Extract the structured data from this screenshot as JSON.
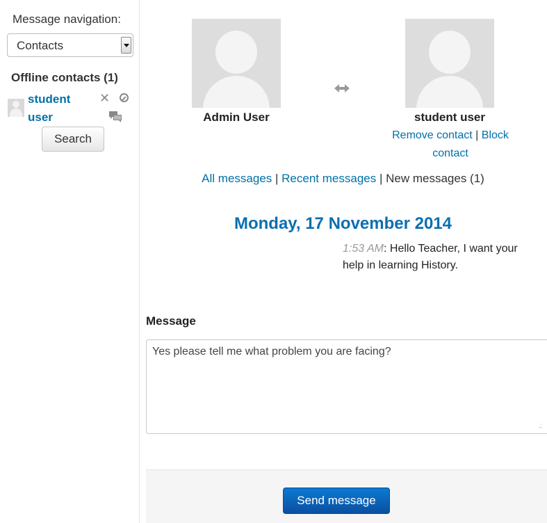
{
  "sidebar": {
    "nav_label": "Message navigation:",
    "select_value": "Contacts",
    "offline_heading": "Offline contacts (1)",
    "contact": {
      "name": "student user",
      "remove_icon": "close-icon",
      "block_icon": "block-icon",
      "chat_icon": "chat-icon"
    },
    "search_label": "Search"
  },
  "conversation": {
    "left_user": "Admin User",
    "right_user": "student user",
    "swap_icon": "double-arrow-icon",
    "remove_contact_label": "Remove contact",
    "separator": " | ",
    "block_contact_label": "Block contact"
  },
  "message_links": {
    "all": "All messages",
    "recent": "Recent messages",
    "new": "New messages (1)",
    "separator": " | "
  },
  "history": {
    "date": "Monday, 17 November 2014",
    "messages": [
      {
        "time": "1:53 AM",
        "separator": ": ",
        "text": "Hello Teacher, I want your help in learning History."
      }
    ]
  },
  "compose": {
    "label": "Message",
    "value": "Yes please tell me what problem you are facing?",
    "send_label": "Send message"
  },
  "colors": {
    "link": "#0070a8",
    "date_heading": "#0b6fb0",
    "send_button": "#0a5db5"
  }
}
